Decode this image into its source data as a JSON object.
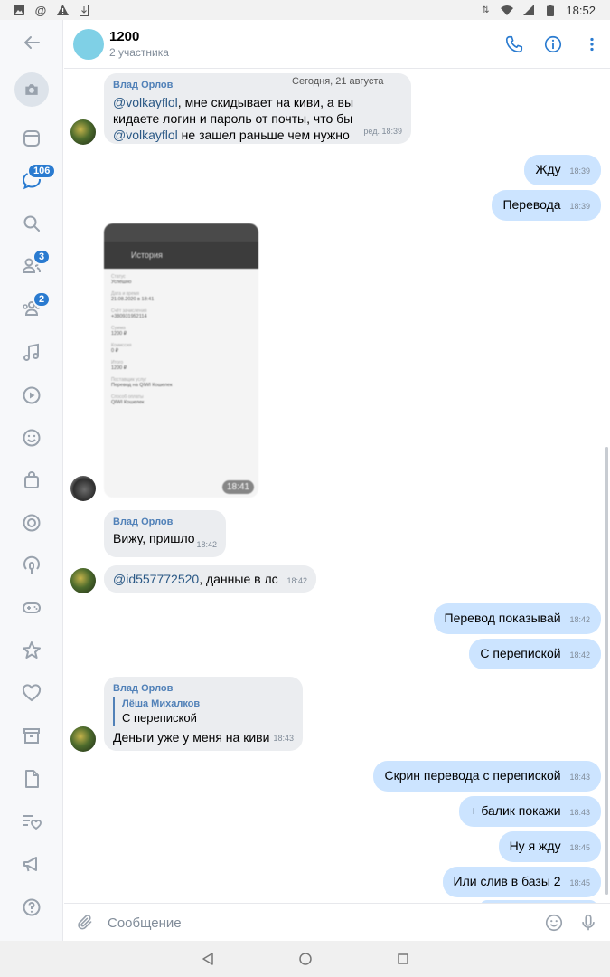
{
  "status_bar": {
    "time": "18:52"
  },
  "rail": {
    "badges": {
      "messages": "106",
      "friends": "3",
      "communities": "2"
    }
  },
  "header": {
    "title": "1200",
    "subtitle": "2 участника"
  },
  "messages": {
    "date_chip": "Сегодня, 21 августа",
    "m1": {
      "sender": "Влад Орлов",
      "mention1": "@volkayflol",
      "text1": ", мне скидывает на киви, а вы кидаете логин и пароль от почты, что бы ",
      "mention2": "@volkayflol",
      "text2": " не зашел раньше чем нужно",
      "time": "ред. 18:39"
    },
    "m2": {
      "text": "Жду",
      "time": "18:39"
    },
    "m3": {
      "text": "Перевода",
      "time": "18:39"
    },
    "photo": {
      "time": "18:41",
      "title": "История",
      "rows": [
        {
          "label": "Статус",
          "value": "Успешно"
        },
        {
          "label": "Дата и время",
          "value": "21.08.2020 в 18:41"
        },
        {
          "label": "Счёт зачисления",
          "value": "+380931952114"
        },
        {
          "label": "Сумма",
          "value": "1200 ₽"
        },
        {
          "label": "Комиссия",
          "value": "0 ₽"
        },
        {
          "label": "Итого",
          "value": "1200 ₽"
        },
        {
          "label": "Поставщик услуг",
          "value": "Перевод на QIWI Кошелек"
        },
        {
          "label": "Способ оплаты",
          "value": "QIWI Кошелек"
        }
      ]
    },
    "m4": {
      "sender": "Влад Орлов",
      "text": "Вижу, пришло",
      "time": "18:42"
    },
    "m5": {
      "mention": "@id557772520",
      "text": ", данные в лс",
      "time": "18:42"
    },
    "m6": {
      "text": "Перевод показывай",
      "time": "18:42"
    },
    "m7": {
      "text": "С перепиской",
      "time": "18:42"
    },
    "m8": {
      "sender": "Влад Орлов",
      "reply_author": "Лёша Михалков",
      "reply_text": "С перепиской",
      "text": "Деньги уже у меня на киви",
      "time": "18:43"
    },
    "m9": {
      "text": "Скрин перевода с перепиской",
      "time": "18:43"
    },
    "m10": {
      "text": "+ балик покажи",
      "time": "18:43"
    },
    "m11": {
      "text": "Ну я жду",
      "time": "18:45"
    },
    "m12": {
      "text": "Или слив в базы 2",
      "time": "18:45"
    }
  },
  "composer": {
    "placeholder": "Сообщение"
  },
  "colors": {
    "accent": "#2a7bd0",
    "outgoing_bubble": "#cce4ff",
    "incoming_bubble": "#ebedf0",
    "sender_name": "#5181b8"
  }
}
